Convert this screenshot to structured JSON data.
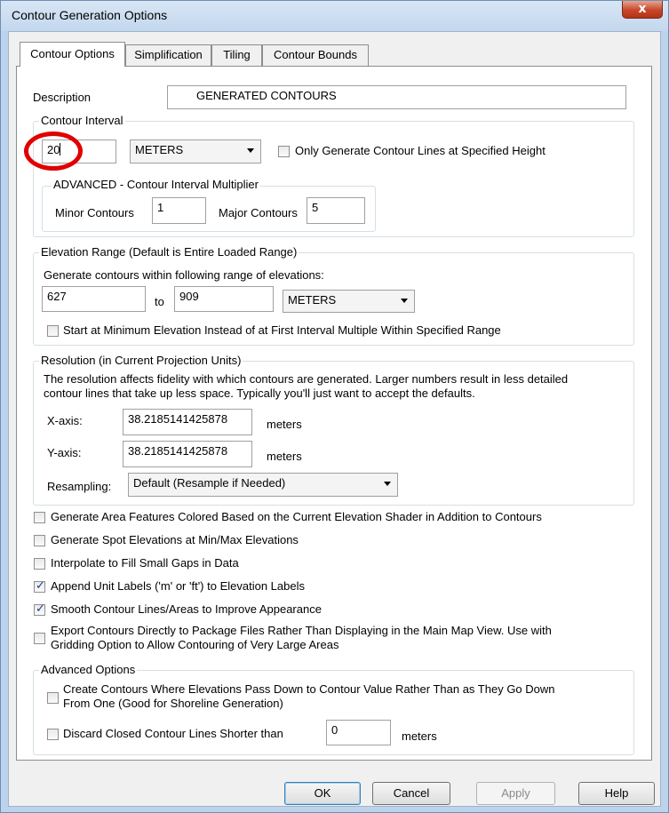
{
  "window": {
    "title": "Contour Generation Options",
    "close_glyph": "x"
  },
  "tabs": [
    {
      "label": "Contour Options",
      "active": true
    },
    {
      "label": "Simplification",
      "active": false
    },
    {
      "label": "Tiling",
      "active": false
    },
    {
      "label": "Contour Bounds",
      "active": false
    }
  ],
  "description": {
    "label": "Description",
    "value": "GENERATED CONTOURS"
  },
  "contour_interval": {
    "legend": "Contour Interval",
    "value": "20",
    "unit": "METERS",
    "only_specified_height_label": "Only Generate Contour Lines at Specified Height",
    "only_specified_height_checked": false,
    "advanced": {
      "legend": "ADVANCED - Contour Interval Multiplier",
      "minor_label": "Minor Contours",
      "minor_value": "1",
      "major_label": "Major Contours",
      "major_value": "5"
    }
  },
  "elevation_range": {
    "legend": "Elevation Range (Default is Entire Loaded Range)",
    "instructions": "Generate contours within following range of elevations:",
    "min": "627",
    "to_label": "to",
    "max": "909",
    "unit": "METERS",
    "start_at_min_label": "Start at Minimum Elevation Instead of at First Interval Multiple Within Specified Range",
    "start_at_min_checked": false
  },
  "resolution": {
    "legend": "Resolution (in Current Projection Units)",
    "desc_line1": "The resolution affects fidelity with which contours are generated. Larger numbers result in less detailed",
    "desc_line2": "contour lines that take up less space. Typically you'll just want to accept the defaults.",
    "x_label": "X-axis:",
    "x_value": "38.2185141425878",
    "x_unit": "meters",
    "y_label": "Y-axis:",
    "y_value": "38.2185141425878",
    "y_unit": "meters",
    "resampling_label": "Resampling:",
    "resampling_value": "Default (Resample if Needed)"
  },
  "options": [
    {
      "label": "Generate Area Features Colored Based on the Current Elevation Shader in Addition to Contours",
      "checked": false
    },
    {
      "label": "Generate Spot Elevations at Min/Max Elevations",
      "checked": false
    },
    {
      "label": "Interpolate to Fill Small Gaps in Data",
      "checked": false
    },
    {
      "label": "Append Unit Labels ('m' or 'ft') to Elevation Labels",
      "checked": true
    },
    {
      "label": "Smooth Contour Lines/Areas to Improve Appearance",
      "checked": true
    },
    {
      "label_line1": "Export Contours Directly to Package Files Rather Than Displaying in the Main Map View. Use with",
      "label_line2": "Gridding Option to Allow Contouring of Very Large Areas",
      "checked": false
    }
  ],
  "advanced_options": {
    "legend": "Advanced Options",
    "pass_down_line1": "Create Contours Where Elevations Pass Down to Contour Value Rather Than as They Go Down",
    "pass_down_line2": "From One (Good for Shoreline Generation)",
    "pass_down_checked": false,
    "discard_label": "Discard Closed Contour Lines Shorter than",
    "discard_value": "0",
    "discard_unit": "meters",
    "discard_checked": false
  },
  "buttons": {
    "ok": "OK",
    "cancel": "Cancel",
    "apply": "Apply",
    "help": "Help"
  },
  "check_glyph": "✓",
  "colors": {
    "highlight_ring": "#e00000",
    "title_bar": "#c3d7ee",
    "close_button": "#c7472a"
  }
}
